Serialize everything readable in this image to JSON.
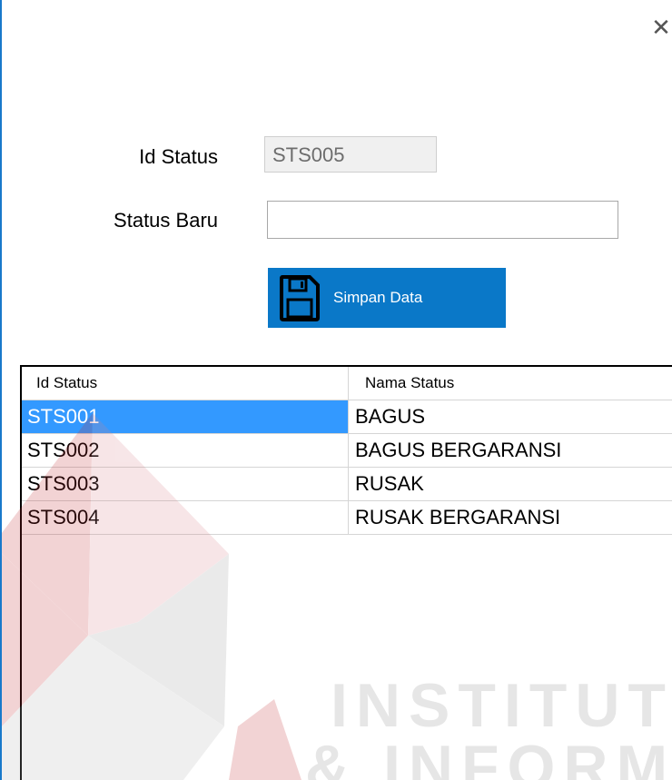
{
  "window": {
    "close_glyph": "✕"
  },
  "form": {
    "id_label": "Id Status",
    "id_value": "STS005",
    "status_label": "Status Baru",
    "status_value": "",
    "save_label": "Simpan Data"
  },
  "grid": {
    "headers": [
      "Id Status",
      "Nama Status"
    ],
    "rows": [
      [
        "STS001",
        "BAGUS"
      ],
      [
        "STS002",
        "BAGUS BERGARANSI"
      ],
      [
        "STS003",
        "RUSAK"
      ],
      [
        "STS004",
        "RUSAK BERGARANSI"
      ]
    ],
    "selected_row": 0
  },
  "watermark": {
    "line1": "INSTITUT BI",
    "line2": "& INFORMA"
  },
  "colors": {
    "accent": "#0a78c8",
    "selection": "#3399ff",
    "border": "#1979ca"
  }
}
